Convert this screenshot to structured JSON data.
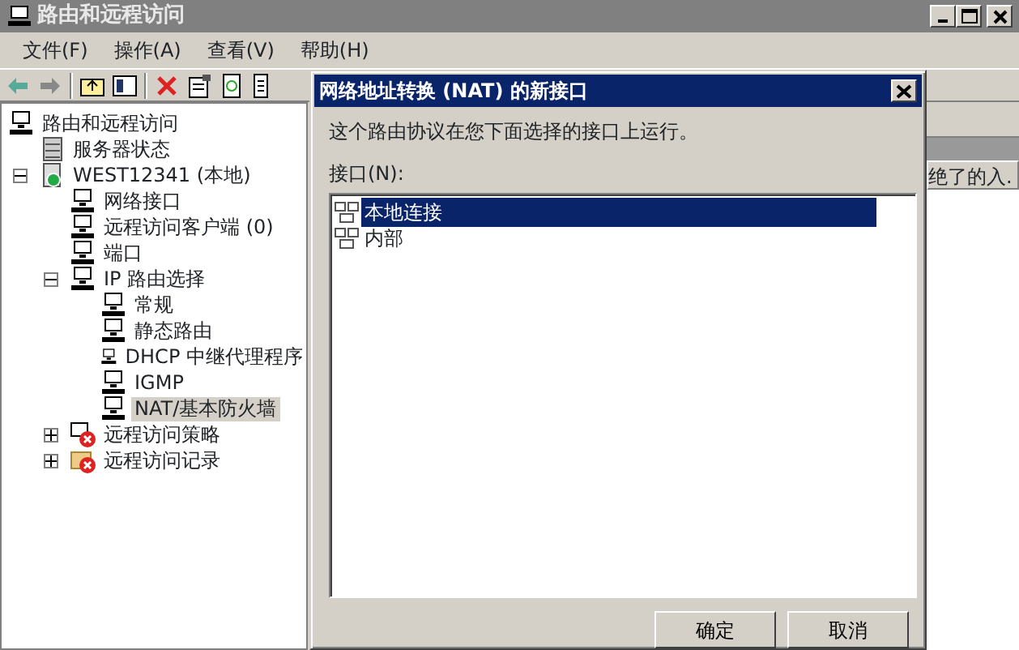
{
  "window": {
    "title": "路由和远程访问"
  },
  "menu": [
    "文件(F)",
    "操作(A)",
    "查看(V)",
    "帮助(H)"
  ],
  "toolbar": [
    {
      "kind": "back"
    },
    {
      "kind": "forward"
    },
    {
      "kind": "sep"
    },
    {
      "kind": "up"
    },
    {
      "kind": "tree"
    },
    {
      "kind": "sep"
    },
    {
      "kind": "delete"
    },
    {
      "kind": "properties"
    },
    {
      "kind": "refresh"
    },
    {
      "kind": "export"
    }
  ],
  "tree": [
    {
      "label": "路由和远程访问",
      "kind": "node",
      "selected": false,
      "children": [
        {
          "label": "服务器状态",
          "kind": "server",
          "selected": false
        },
        {
          "label": "WEST12341 (本地)",
          "kind": "computer",
          "selected": false,
          "expanded": true,
          "children": [
            {
              "label": "网络接口",
              "kind": "node",
              "selected": false
            },
            {
              "label": "远程访问客户端 (0)",
              "kind": "node",
              "selected": false
            },
            {
              "label": "端口",
              "kind": "node",
              "selected": false
            },
            {
              "label": "IP 路由选择",
              "kind": "node",
              "selected": false,
              "expanded": true,
              "children": [
                {
                  "label": "常规",
                  "kind": "node",
                  "selected": false
                },
                {
                  "label": "静态路由",
                  "kind": "node",
                  "selected": false
                },
                {
                  "label": "DHCP 中继代理程序",
                  "kind": "node",
                  "selected": false
                },
                {
                  "label": "IGMP",
                  "kind": "node",
                  "selected": false
                },
                {
                  "label": "NAT/基本防火墙",
                  "kind": "node",
                  "selected": true
                }
              ]
            },
            {
              "label": "远程访问策略",
              "kind": "policy",
              "selected": false,
              "expanded": false
            },
            {
              "label": "远程访问记录",
              "kind": "log",
              "selected": false,
              "expanded": false
            }
          ]
        }
      ]
    }
  ],
  "column_header": "绝了的入.",
  "dialog": {
    "title": "网络地址转换 (NAT) 的新接口",
    "message": "这个路由协议在您下面选择的接口上运行。",
    "list_label": "接口(N):",
    "interfaces": [
      {
        "label": "本地连接",
        "selected": true
      },
      {
        "label": "内部",
        "selected": false
      }
    ],
    "buttons": [
      "确定",
      "取消"
    ]
  }
}
